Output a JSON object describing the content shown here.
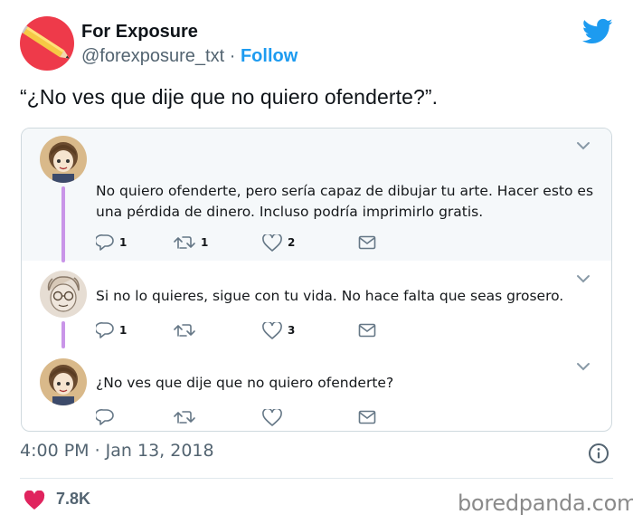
{
  "author": {
    "name": "For Exposure",
    "handle": "@forexposure_txt",
    "separator": "·",
    "follow_label": "Follow",
    "avatar_color": "#ee3a4a"
  },
  "tweet": {
    "text": "“¿No ves que dije que no quiero ofenderte?”.",
    "timestamp": "4:00 PM · Jan 13, 2018",
    "likes": "7.8K"
  },
  "thread": [
    {
      "text": "No quiero ofenderte, pero sería capaz de dibujar tu arte. Hacer esto es una pérdida de dinero. Incluso podría imprimirlo gratis.",
      "replies": "1",
      "retweets": "1",
      "likes": "2"
    },
    {
      "text": "Si no lo quieres, sigue con tu vida. No hace falta que seas grosero.",
      "replies": "1",
      "retweets": "",
      "likes": "3"
    },
    {
      "text": "¿No ves que dije que no quiero ofenderte?",
      "replies": "",
      "retweets": "",
      "likes": ""
    }
  ],
  "icons": {
    "brand": "twitter-bird-icon",
    "reply": "reply-icon",
    "retweet": "retweet-icon",
    "like": "heart-outline-icon",
    "dm": "envelope-icon",
    "more": "chevron-down-icon",
    "info": "info-icon",
    "like_filled": "heart-filled-icon"
  },
  "colors": {
    "twitter_blue": "#1d9bf0",
    "thread_line": "#c995e8",
    "heart": "#e0245e"
  },
  "watermark": "boredpanda.com"
}
